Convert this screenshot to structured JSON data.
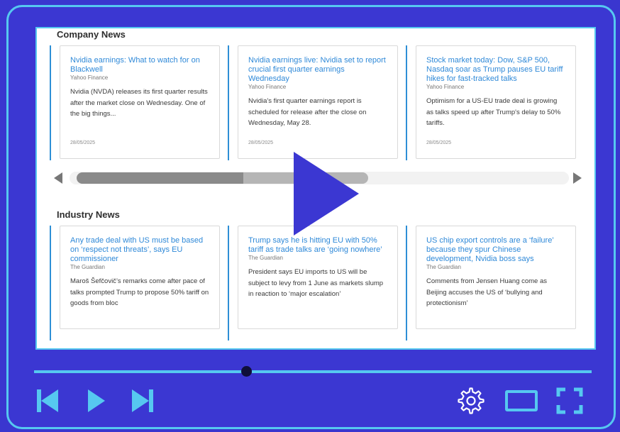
{
  "company_news": {
    "title": "Company News",
    "cards": [
      {
        "title": "Nvidia earnings: What to watch for on Blackwell",
        "source": "Yahoo Finance",
        "body": "Nvidia (NVDA) releases its first quarter results after the market close on Wednesday. One of the big things...",
        "date": "28/05/2025"
      },
      {
        "title": "Nvidia earnings live: Nvidia set to report crucial first quarter earnings Wednesday",
        "source": "Yahoo Finance",
        "body": "Nvidia's first quarter earnings report is scheduled for release after the close on Wednesday, May 28.",
        "date": "28/05/2025"
      },
      {
        "title": "Stock market today: Dow, S&P 500, Nasdaq soar as Trump pauses EU tariff hikes for fast-tracked talks",
        "source": "Yahoo Finance",
        "body": "Optimism for a US-EU trade deal is growing as talks speed up after Trump's delay to 50% tariffs.",
        "date": "28/05/2025"
      }
    ]
  },
  "industry_news": {
    "title": "Industry News",
    "cards": [
      {
        "title": "Any trade deal with US must be based on ‘respect not threats’, says EU commissioner",
        "source": "The Guardian",
        "body": "Maroš Šefčovič’s remarks come after pace of talks prompted Trump to propose 50% tariff on goods from bloc"
      },
      {
        "title": "Trump says he is hitting EU with 50% tariff as trade talks are ‘going nowhere’",
        "source": "The Guardian",
        "body": "President says EU imports to US will be subject to levy from 1 June as markets slump in reaction to ‘major escalation’"
      },
      {
        "title": "US chip export controls are a ‘failure’ because they spur Chinese development, Nvidia boss says",
        "source": "The Guardian",
        "body": "Comments from Jensen Huang come as Beijing accuses the US of ‘bullying and protectionism’"
      }
    ]
  },
  "player": {
    "progress_fraction": 0.38,
    "icons": [
      "play-icon",
      "skip-back-icon",
      "skip-forward-icon",
      "gear-icon",
      "theater-mode-icon",
      "fullscreen-icon"
    ]
  },
  "colors": {
    "frame": "#3b37d2",
    "accent": "#56c8f0",
    "link": "#2f89d8",
    "knob": "#0f0f3a"
  }
}
